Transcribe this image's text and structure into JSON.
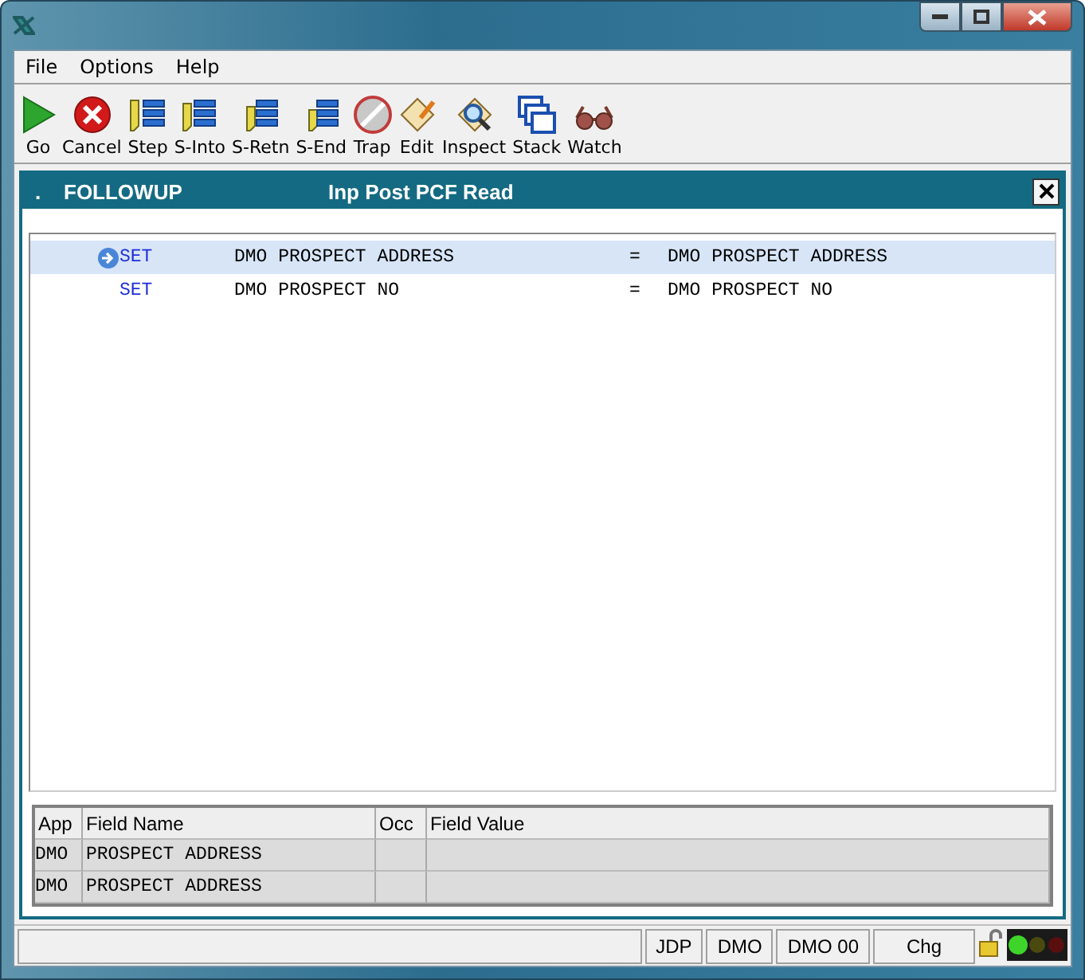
{
  "menu": [
    "File",
    "Options",
    "Help"
  ],
  "toolbar": [
    {
      "label": "Go"
    },
    {
      "label": "Cancel"
    },
    {
      "label": "Step"
    },
    {
      "label": "S-Into"
    },
    {
      "label": "S-Retn"
    },
    {
      "label": "S-End"
    },
    {
      "label": "Trap"
    },
    {
      "label": "Edit"
    },
    {
      "label": "Inspect"
    },
    {
      "label": "Stack"
    },
    {
      "label": "Watch"
    }
  ],
  "panel": {
    "marker": ".",
    "program": "FOLLOWUP",
    "title": "Inp Post PCF Read"
  },
  "listing": [
    {
      "current": true,
      "verb": "SET",
      "target": "DMO PROSPECT ADDRESS",
      "operator": "=",
      "source": "DMO PROSPECT ADDRESS"
    },
    {
      "current": false,
      "verb": "SET",
      "target": "DMO PROSPECT NO",
      "operator": "=",
      "source": "DMO PROSPECT NO"
    }
  ],
  "table": {
    "columns": [
      "App",
      "Field Name",
      "Occ",
      "Field Value"
    ],
    "rows": [
      [
        "DMO",
        "PROSPECT ADDRESS"
      ],
      [
        "DMO",
        "PROSPECT ADDRESS"
      ]
    ]
  },
  "status_bar": [
    "JDP",
    "DMO",
    "DMO 00",
    "Chg"
  ]
}
